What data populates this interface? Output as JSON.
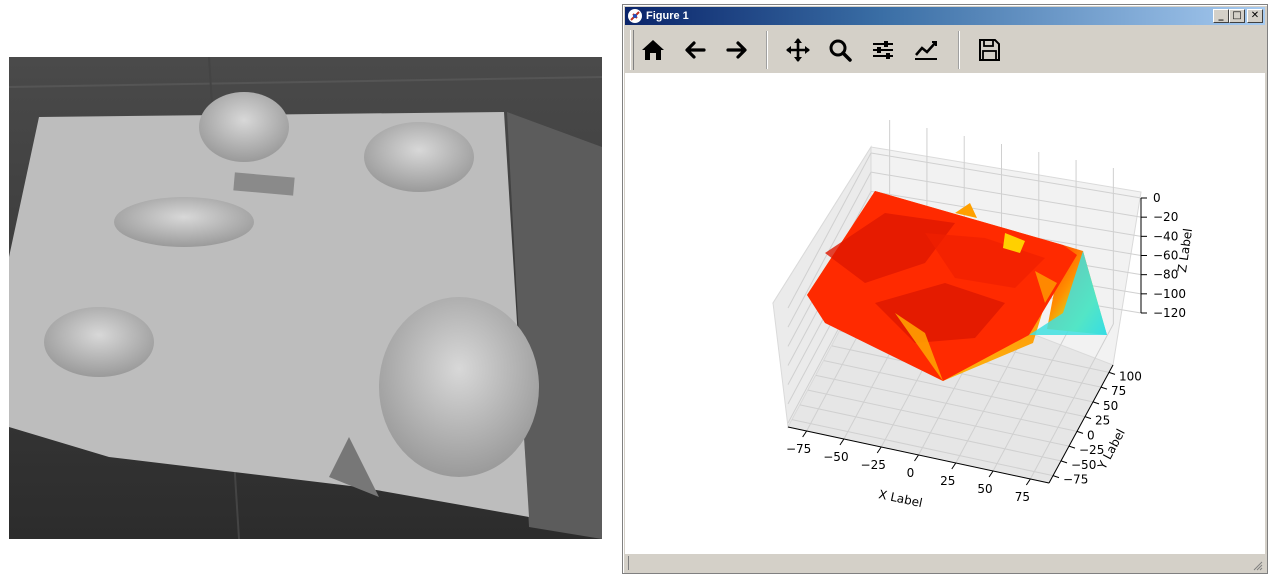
{
  "window": {
    "title": "Figure 1",
    "minimize_glyph": "_",
    "maximize_glyph": "□",
    "close_glyph": "✕"
  },
  "toolbar": {
    "buttons": [
      {
        "name": "home",
        "icon": "home-icon"
      },
      {
        "name": "back",
        "icon": "arrow-left-icon"
      },
      {
        "name": "forward",
        "icon": "arrow-right-icon"
      },
      {
        "name": "pan",
        "icon": "move-icon"
      },
      {
        "name": "zoom",
        "icon": "magnifier-icon"
      },
      {
        "name": "configure-subplots",
        "icon": "sliders-icon"
      },
      {
        "name": "edit-axis",
        "icon": "line-chart-icon"
      },
      {
        "name": "save",
        "icon": "floppy-disk-icon"
      }
    ]
  },
  "photo": {
    "description_icon": "clay-terrain-photo"
  },
  "chart_data": {
    "type": "surface3d",
    "colormap": "jet",
    "xlabel": "X Label",
    "ylabel": "Y Label",
    "zlabel": "Z Label",
    "x_ticks": [
      "−75",
      "−50",
      "−25",
      "0",
      "25",
      "50",
      "75"
    ],
    "y_ticks": [
      "−75",
      "−50",
      "−25",
      "0",
      "25",
      "50",
      "75",
      "100"
    ],
    "z_ticks": [
      "0",
      "−20",
      "−40",
      "−60",
      "−80",
      "−100",
      "−120"
    ],
    "xlim": [
      -100,
      100
    ],
    "ylim": [
      -90,
      120
    ],
    "zlim": [
      -140,
      10
    ],
    "grid": true
  }
}
